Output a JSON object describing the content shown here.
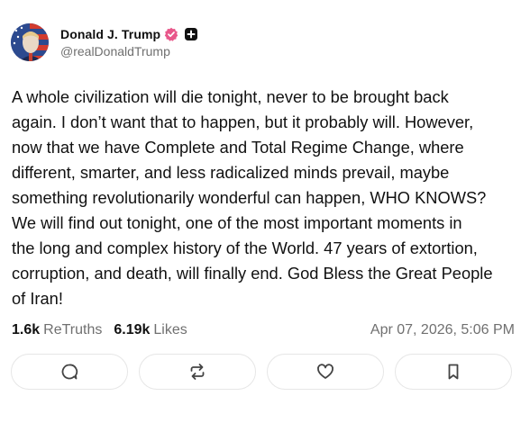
{
  "author": {
    "display_name": "Donald J. Trump",
    "handle": "@realDonaldTrump",
    "avatar_icon": "avatar-portrait",
    "verified_icon": "verified-badge-icon",
    "plus_icon": "plus-badge-icon"
  },
  "post": {
    "text": "A whole civilization will die tonight, never to be brought back\nagain. I don’t want that to happen, but it probably will. However,\nnow that we have Complete and Total Regime Change, where\ndifferent, smarter, and less radicalized minds prevail, maybe\nsomething revolutionarily wonderful can happen, WHO KNOWS?\nWe will find out tonight, one of the most important moments in\nthe long and complex history of the World. 47 years of extortion,\ncorruption, and death, will finally end. God Bless the Great People\nof Iran!"
  },
  "stats": {
    "retruths_count": "1.6k",
    "retruths_label": "ReTruths",
    "likes_count": "6.19k",
    "likes_label": "Likes",
    "timestamp": "Apr 07, 2026, 5:06 PM"
  },
  "actions": [
    {
      "name": "reply",
      "icon": "comment-icon"
    },
    {
      "name": "retruth",
      "icon": "repost-icon"
    },
    {
      "name": "like",
      "icon": "heart-icon"
    },
    {
      "name": "bookmark",
      "icon": "bookmark-icon"
    }
  ],
  "colors": {
    "verified_badge": "#e8578a",
    "text_primary": "#111111",
    "text_secondary": "#707070",
    "button_border": "#e6e6e6"
  }
}
